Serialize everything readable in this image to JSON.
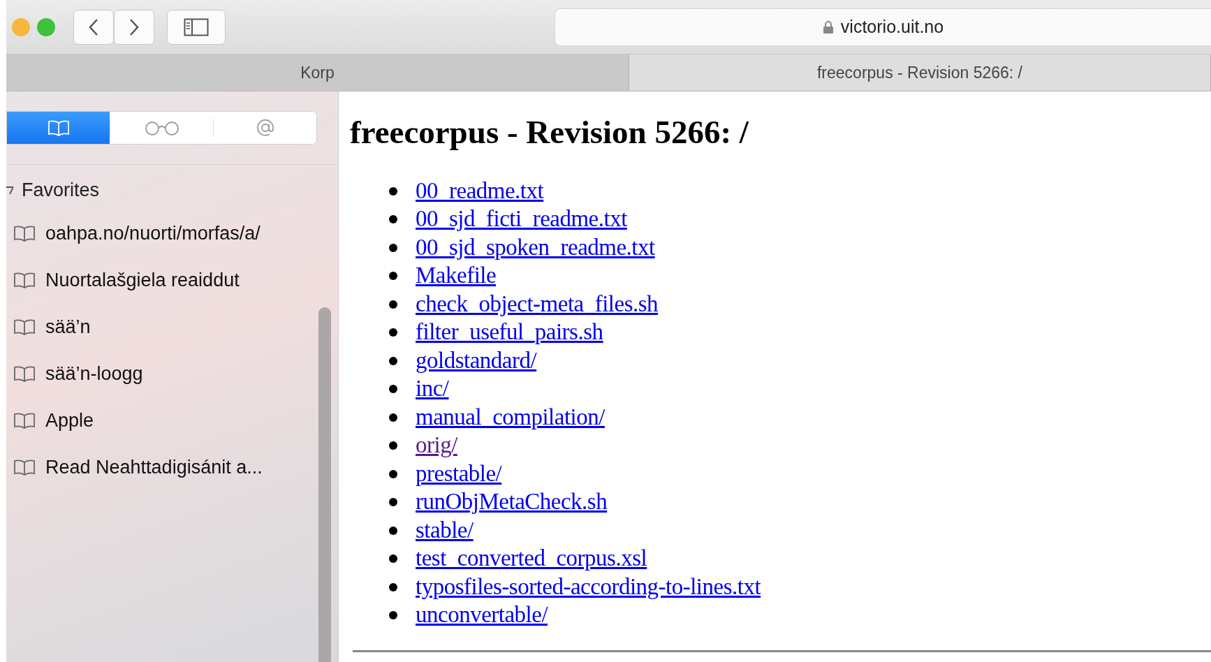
{
  "toolbar": {
    "address": "victorio.uit.no",
    "secure": true
  },
  "tabs": [
    {
      "label": "Korp",
      "selected": false
    },
    {
      "label": "freecorpus - Revision 5266: /",
      "selected": true
    }
  ],
  "sidebar": {
    "segments": [
      {
        "kind": "bookmarks",
        "selected": true
      },
      {
        "kind": "reading-list",
        "selected": false
      },
      {
        "kind": "shared-links",
        "selected": false
      }
    ],
    "section": {
      "label": "Favorites",
      "expanded": true
    },
    "items": [
      {
        "label": "oahpa.no/nuorti/morfas/a/"
      },
      {
        "label": "Nuortalašgiela reaiddut"
      },
      {
        "label": "sää’n"
      },
      {
        "label": "sää’n-loogg"
      },
      {
        "label": "Apple"
      },
      {
        "label": "Read Neahttadigisánit a..."
      }
    ]
  },
  "page": {
    "heading": "freecorpus - Revision 5266: /",
    "links": [
      {
        "label": "00_readme.txt",
        "visited": false
      },
      {
        "label": "00_sjd_ficti_readme.txt",
        "visited": false
      },
      {
        "label": "00_sjd_spoken_readme.txt",
        "visited": false
      },
      {
        "label": "Makefile",
        "visited": false
      },
      {
        "label": "check_object-meta_files.sh",
        "visited": false
      },
      {
        "label": "filter_useful_pairs.sh",
        "visited": false
      },
      {
        "label": "goldstandard/",
        "visited": false
      },
      {
        "label": "inc/",
        "visited": false
      },
      {
        "label": "manual_compilation/",
        "visited": false
      },
      {
        "label": "orig/",
        "visited": true
      },
      {
        "label": "prestable/",
        "visited": false
      },
      {
        "label": "runObjMetaCheck.sh",
        "visited": false
      },
      {
        "label": "stable/",
        "visited": false
      },
      {
        "label": "test_converted_corpus.xsl",
        "visited": false
      },
      {
        "label": "typosfiles-sorted-according-to-lines.txt",
        "visited": false
      },
      {
        "label": "unconvertable/",
        "visited": false
      }
    ]
  }
}
